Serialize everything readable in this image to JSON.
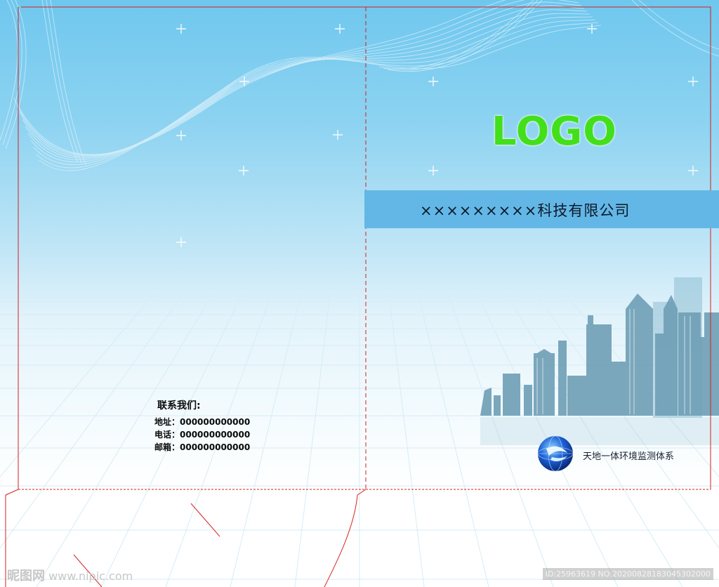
{
  "cover": {
    "logo_text": "LOGO",
    "company_name": "×××××××××科技有限公司",
    "tagline": "天地一体环境监测体系"
  },
  "contact": {
    "title": "联系我们:",
    "address": "地址：000000000000",
    "phone": "电话：000000000000",
    "email": "邮箱：000000000000"
  },
  "watermark": {
    "left_text": "昵图网",
    "left_url": "www.nipic.com",
    "right_text": "ID:25963619 NO:20200828183045302000"
  },
  "colors": {
    "logo_green": "#43df1b",
    "band_blue": "#63b7e6",
    "sky_blue": "#6fc7ee",
    "dieline_red": "#d42020"
  },
  "icons": {
    "globe": "globe-icon",
    "skyline": "city-skyline-icon"
  }
}
